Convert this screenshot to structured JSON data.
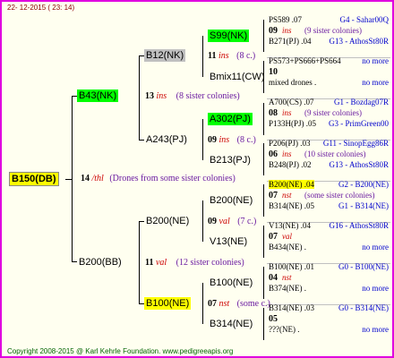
{
  "header": {
    "date": "22- 12-2015 ( 23: 14)"
  },
  "footer": {
    "copyright": "Copyright 2008-2015 @ Karl Kehrle Foundation.   www.pedigreeapis.org"
  },
  "root": {
    "id": "B150(DB)",
    "num": "14",
    "code": "/thl",
    "desc": "(Drones from some sister colonies)"
  },
  "gen1": {
    "top": {
      "id": "B43(NK)",
      "num": "13",
      "code": "ins",
      "desc": "(8 sister colonies)"
    },
    "bottom": {
      "id": "B200(BB)",
      "num": "11",
      "code": "val",
      "desc": "(12 sister colonies)"
    }
  },
  "gen2": {
    "a": {
      "id": "B12(NK)",
      "num": "11",
      "code": "ins",
      "desc": "(8 c.)"
    },
    "b": {
      "id": "A243(PJ)",
      "num": "09",
      "code": "ins",
      "desc": "(8 c.)"
    },
    "c": {
      "id": "B200(NE)",
      "num": "09",
      "code": "val",
      "desc": "(7 c.)"
    },
    "d": {
      "id": "B100(NE)",
      "num": "07",
      "code": "nst",
      "desc": "(some c.)"
    }
  },
  "gen3": {
    "a1": "S99(NK)",
    "a2": "Bmix11(CW)",
    "b1": "A302(PJ)",
    "b2": "B213(PJ)",
    "c1": "B200(NE)",
    "c2": "V13(NE)",
    "d1": "B100(NE)",
    "d2": "B314(NE)"
  },
  "gen4": [
    {
      "top": "PS589 .07",
      "top_r": "G4 - Sahar00Q",
      "num": "09",
      "code": "ins",
      "desc": "(9 sister colonies)",
      "bot": "B271(PJ) .04",
      "bot_r": "G13 - AthosSt80R"
    },
    {
      "top": "PS573+PS666+PS664",
      "top_r": "no more",
      "num": "10",
      "code": "",
      "desc": "",
      "bot": "mixed drones .",
      "bot_r": "no more"
    },
    {
      "top": "A700(CS) .07",
      "top_r": "G1 - Bozdag07R",
      "num": "08",
      "code": "ins",
      "desc": "(9 sister colonies)",
      "bot": "P133H(PJ) .05",
      "bot_r": "G3 - PrimGreen00"
    },
    {
      "top": "P206(PJ) .03",
      "top_r": "G11 - SinopEgg86R",
      "num": "06",
      "code": "ins",
      "desc": "(10 sister colonies)",
      "bot": "B248(PJ) .02",
      "bot_r": "G13 - AthosSt80R"
    },
    {
      "top": "B200(NE) .04",
      "top_r": "G2 - B200(NE)",
      "num": "07",
      "code": "nst",
      "desc": "(some sister colonies)",
      "bot": "B314(NE) .05",
      "bot_r": "G1 - B314(NE)"
    },
    {
      "top": "V13(NE) .04",
      "top_r": "G16 - AthosSt80R",
      "num": "07",
      "code": "val",
      "desc": "",
      "bot": "B434(NE) .",
      "bot_r": "no more"
    },
    {
      "top": "B100(NE) .01",
      "top_r": "G0 - B100(NE)",
      "num": "04",
      "code": "nst",
      "desc": "",
      "bot": "B374(NE) .",
      "bot_r": "no more"
    },
    {
      "top": "B314(NE) .03",
      "top_r": "G0 - B314(NE)",
      "num": "05",
      "code": "",
      "desc": "",
      "bot": "???(NE) .",
      "bot_r": "no more"
    }
  ],
  "colors": {
    "frame": "#e000e0",
    "root_box": "#ffff00",
    "green_box": "#00ff00",
    "gray_box": "#c0c0c0",
    "yellow_box": "#ffff00",
    "name_color": "#0000cc",
    "code_color": "#cc0000",
    "desc_color": "#6a1aa0"
  }
}
